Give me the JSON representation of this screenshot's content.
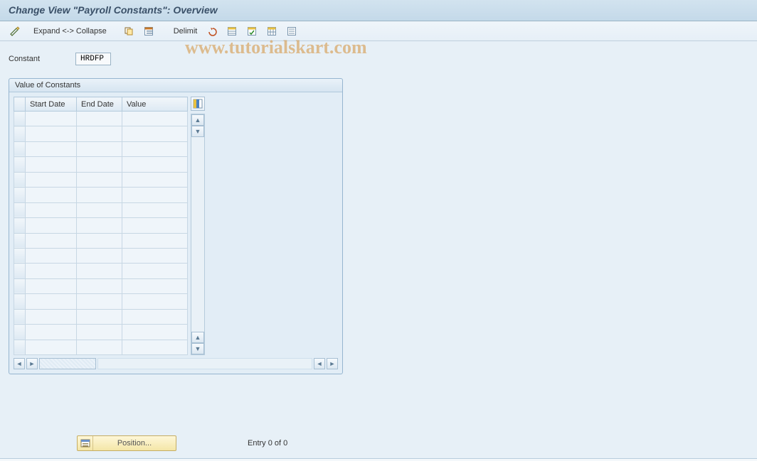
{
  "title": "Change View \"Payroll Constants\": Overview",
  "toolbar": {
    "expand_collapse": "Expand <-> Collapse",
    "delimit": "Delimit"
  },
  "watermark": "www.tutorialskart.com",
  "constant": {
    "label": "Constant",
    "value": "HRDFP"
  },
  "panel": {
    "title": "Value of Constants",
    "columns": {
      "start_date": "Start Date",
      "end_date": "End Date",
      "value": "Value"
    },
    "rows": [
      {
        "start_date": "",
        "end_date": "",
        "value": ""
      },
      {
        "start_date": "",
        "end_date": "",
        "value": ""
      },
      {
        "start_date": "",
        "end_date": "",
        "value": ""
      },
      {
        "start_date": "",
        "end_date": "",
        "value": ""
      },
      {
        "start_date": "",
        "end_date": "",
        "value": ""
      },
      {
        "start_date": "",
        "end_date": "",
        "value": ""
      },
      {
        "start_date": "",
        "end_date": "",
        "value": ""
      },
      {
        "start_date": "",
        "end_date": "",
        "value": ""
      },
      {
        "start_date": "",
        "end_date": "",
        "value": ""
      },
      {
        "start_date": "",
        "end_date": "",
        "value": ""
      },
      {
        "start_date": "",
        "end_date": "",
        "value": ""
      },
      {
        "start_date": "",
        "end_date": "",
        "value": ""
      },
      {
        "start_date": "",
        "end_date": "",
        "value": ""
      },
      {
        "start_date": "",
        "end_date": "",
        "value": ""
      },
      {
        "start_date": "",
        "end_date": "",
        "value": ""
      },
      {
        "start_date": "",
        "end_date": "",
        "value": ""
      }
    ]
  },
  "footer": {
    "position_label": "Position...",
    "entry_text": "Entry 0 of 0"
  }
}
